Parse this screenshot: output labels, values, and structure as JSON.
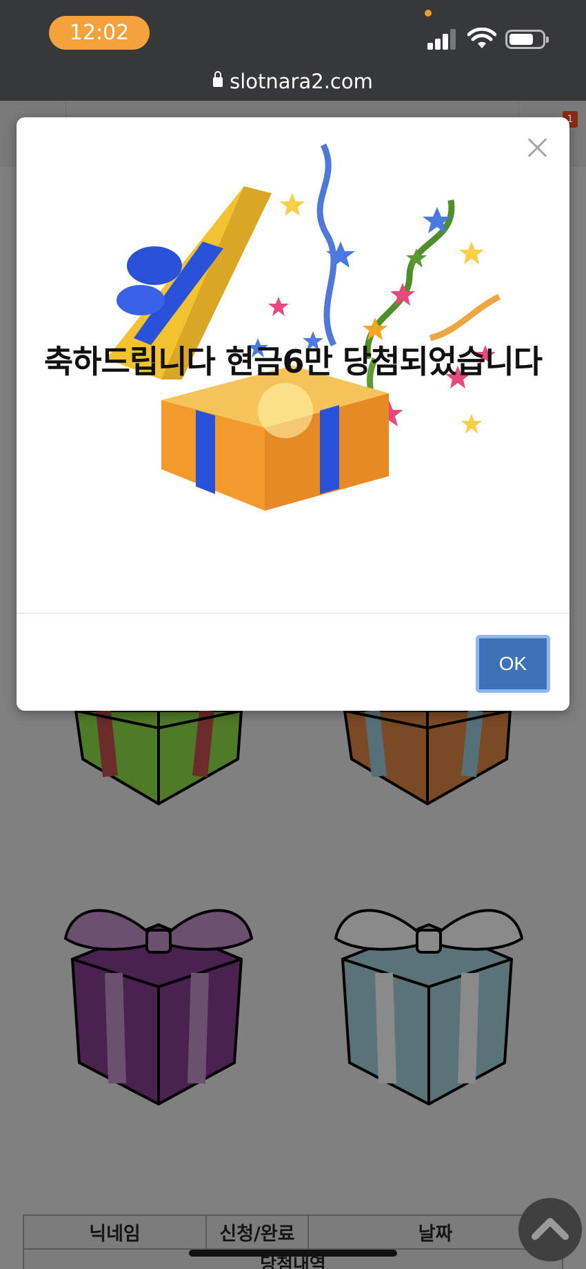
{
  "status_bar": {
    "time": "12:02"
  },
  "browser": {
    "url": "slotnara2.com"
  },
  "header": {
    "notification_count": "1"
  },
  "modal": {
    "message": "축하드립니다 현금6만 당첨되었습니다",
    "ok_label": "OK"
  },
  "winners_table": {
    "headers": [
      "닉네임",
      "신청/완료",
      "날짜"
    ],
    "caption": "당첨내역"
  },
  "colors": {
    "overlay": "#808080",
    "ok_button": "#3d72b8",
    "time_pill": "#f4a23c",
    "gift_green": "#4f7a28",
    "gift_brown": "#7a4a26",
    "gift_purple": "#4a2250",
    "gift_teal": "#5a7378"
  }
}
